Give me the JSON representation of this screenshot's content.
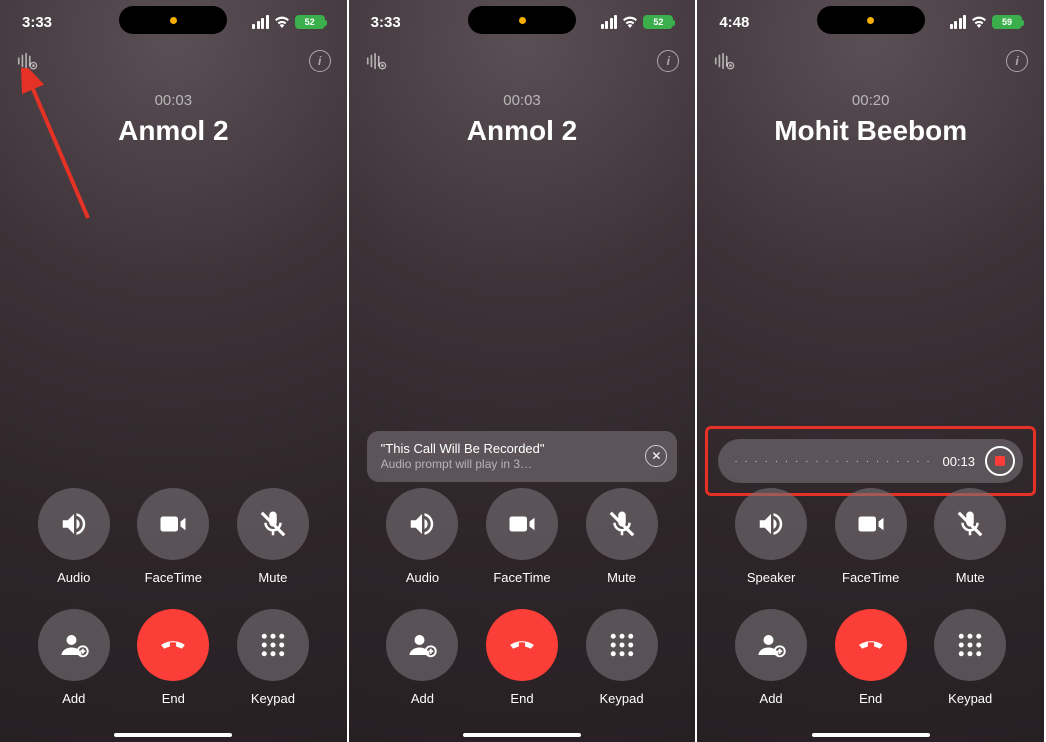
{
  "panels": [
    {
      "status": {
        "time": "3:33",
        "battery": "52"
      },
      "duration": "00:03",
      "caller": "Anmol 2",
      "buttons": [
        {
          "label": "Audio",
          "icon": "speaker"
        },
        {
          "label": "FaceTime",
          "icon": "facetime"
        },
        {
          "label": "Mute",
          "icon": "mute"
        },
        {
          "label": "Add",
          "icon": "add"
        },
        {
          "label": "End",
          "icon": "end",
          "red": true
        },
        {
          "label": "Keypad",
          "icon": "keypad"
        }
      ],
      "annotation_arrow": true
    },
    {
      "status": {
        "time": "3:33",
        "battery": "52"
      },
      "duration": "00:03",
      "caller": "Anmol 2",
      "notice": {
        "title": "\"This Call Will Be Recorded\"",
        "subtitle": "Audio prompt will play in 3…"
      },
      "buttons": [
        {
          "label": "Audio",
          "icon": "speaker"
        },
        {
          "label": "FaceTime",
          "icon": "facetime"
        },
        {
          "label": "Mute",
          "icon": "mute"
        },
        {
          "label": "Add",
          "icon": "add"
        },
        {
          "label": "End",
          "icon": "end",
          "red": true
        },
        {
          "label": "Keypad",
          "icon": "keypad"
        }
      ]
    },
    {
      "status": {
        "time": "4:48",
        "battery": "59"
      },
      "duration": "00:20",
      "caller": "Mohit Beebom",
      "recording": {
        "elapsed": "00:13"
      },
      "buttons": [
        {
          "label": "Speaker",
          "icon": "speaker"
        },
        {
          "label": "FaceTime",
          "icon": "facetime"
        },
        {
          "label": "Mute",
          "icon": "mute"
        },
        {
          "label": "Add",
          "icon": "add"
        },
        {
          "label": "End",
          "icon": "end",
          "red": true
        },
        {
          "label": "Keypad",
          "icon": "keypad"
        }
      ],
      "recording_highlight": true
    }
  ]
}
